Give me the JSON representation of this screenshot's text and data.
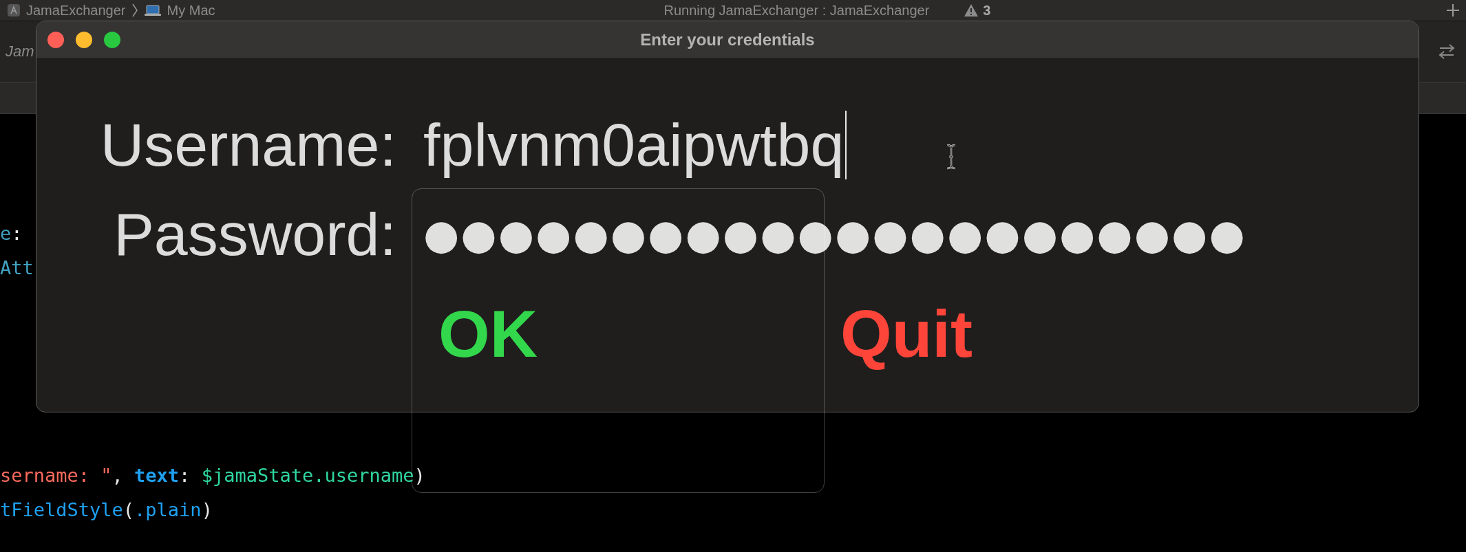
{
  "xcode": {
    "toolbar": {
      "scheme": "JamaExchanger",
      "destination": "My Mac",
      "status": "Running JamaExchanger : JamaExchanger",
      "warnings": "3"
    },
    "tab_bar": {
      "tab": "Jam"
    },
    "editor": {
      "upper_lines": [
        [
          {
            "text": "e",
            "kind": "type"
          },
          {
            "text": ":",
            "kind": "plain"
          }
        ],
        [
          {
            "text": "Att",
            "kind": "type"
          }
        ]
      ],
      "lower_lines": [
        [
          {
            "text": "sername: \"",
            "kind": "string"
          },
          {
            "text": ", ",
            "kind": "plain"
          },
          {
            "text": "text",
            "kind": "label"
          },
          {
            "text": ": ",
            "kind": "plain"
          },
          {
            "text": "$jamaState.username",
            "kind": "variable"
          },
          {
            "text": ")",
            "kind": "plain"
          }
        ],
        [
          {
            "text": "tFieldStyle",
            "kind": "method"
          },
          {
            "text": "(",
            "kind": "plain"
          },
          {
            "text": ".plain",
            "kind": "method"
          },
          {
            "text": ")",
            "kind": "plain"
          }
        ]
      ]
    }
  },
  "dialog": {
    "title": "Enter your credentials",
    "fields": [
      {
        "label": "Username:",
        "kind": "text",
        "value": "fplvnm0aipwtbq",
        "focused": true
      },
      {
        "label": "Password:",
        "kind": "secure",
        "value": "●●●●●●●●●●●●●●●●●●●●●●",
        "focused": false
      }
    ],
    "buttons": [
      {
        "label": "OK",
        "kind": "confirm"
      },
      {
        "label": "Quit",
        "kind": "cancel"
      }
    ]
  }
}
